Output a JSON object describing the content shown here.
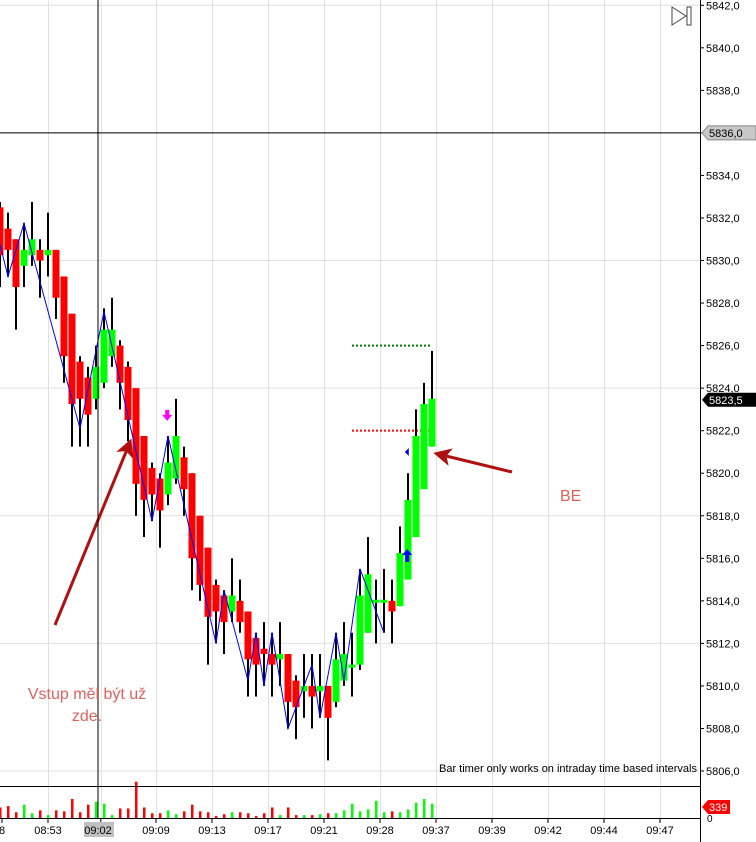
{
  "chart_data": {
    "type": "candlestick",
    "title": "",
    "price_axis": {
      "min": 5806,
      "max": 5842,
      "step": 2,
      "decimal_sep": ","
    },
    "grid_price_levels": [
      5806,
      5812,
      5818,
      5824,
      5830,
      5836,
      5842
    ],
    "price_labels": [
      "5806,0",
      "5808,0",
      "5810,0",
      "5812,0",
      "5814,0",
      "5816,0",
      "5818,0",
      "5820,0",
      "5822,0",
      "5824,0",
      "5826,0",
      "5828,0",
      "5830,0",
      "5832,0",
      "5834,0",
      "5836,0",
      "5838,0",
      "5840,0",
      "5842,0"
    ],
    "time_labels": [
      "8",
      "08:53",
      "09:02",
      "09:09",
      "09:13",
      "09:17",
      "09:21",
      "09:28",
      "09:37",
      "09:39",
      "09:42",
      "09:44",
      "09:47"
    ],
    "time_label_bar_index": [
      -6,
      6,
      12.6,
      19.5,
      26.5,
      33.5,
      40.5,
      47.5,
      54.5,
      61.5,
      68.5,
      75.5,
      82.5
    ],
    "crosshair": {
      "price": 5836,
      "price_label": "5836,0",
      "time_label": "09:02",
      "bar_index": 12.25
    },
    "current_price": {
      "value": 5823.5,
      "label": "5823,5"
    },
    "open": [
      5832.5,
      5831.5,
      5831,
      5829.75,
      5830.25,
      5830.5,
      5830.25,
      5830.5,
      5829.25,
      5827.5,
      5825.25,
      5824.5,
      5823.5,
      5824.25,
      5825.5,
      5826,
      5825,
      5824,
      5821.75,
      5820.25,
      5819.75,
      5819,
      5819.75,
      5820.75,
      5820,
      5818,
      5816.5,
      5814.75,
      5814.25,
      5813.5,
      5814,
      5813.5,
      5812.25,
      5811.75,
      5811.5,
      5811.25,
      5811.5,
      5810.25,
      5809.75,
      5810,
      5809.75,
      5810,
      5809.25,
      5810.25,
      5811,
      5811,
      5812.5,
      5814,
      5814,
      5814,
      5813.75,
      5815,
      5817,
      5819.25,
      5821.25
    ],
    "high": [
      5832.75,
      5832.25,
      5831,
      5831.75,
      5832.75,
      5831,
      5832.25,
      5830.5,
      5829.25,
      5827.5,
      5825.5,
      5825,
      5826,
      5827.75,
      5828.25,
      5826.25,
      5825.25,
      5824,
      5821.75,
      5820.5,
      5820,
      5821.75,
      5823.5,
      5821.25,
      5820,
      5818,
      5816.5,
      5815,
      5814.5,
      5816,
      5815,
      5813.5,
      5812.5,
      5813,
      5812.5,
      5813,
      5811.5,
      5810.5,
      5811.5,
      5811.5,
      5811.5,
      5810,
      5812.5,
      5813,
      5812.5,
      5815.5,
      5817,
      5815,
      5815.5,
      5815,
      5817.5,
      5820,
      5823,
      5824.25,
      5825.75
    ],
    "low": [
      5828.75,
      5829.25,
      5826.75,
      5828.75,
      5829.75,
      5828.25,
      5829.25,
      5827.25,
      5824.25,
      5821.25,
      5821.25,
      5821.25,
      5823,
      5824,
      5825,
      5823,
      5821.5,
      5818,
      5817,
      5817.75,
      5816.5,
      5818.5,
      5819.5,
      5818,
      5814.5,
      5814,
      5811,
      5812,
      5811.5,
      5813,
      5812.5,
      5809.5,
      5809.5,
      5810,
      5809.5,
      5810,
      5808,
      5807.5,
      5808.5,
      5808,
      5808.5,
      5806.5,
      5809,
      5810,
      5809.5,
      5810.75,
      5812.5,
      5812,
      5812.5,
      5812,
      5813.75,
      5815,
      5817,
      5819.25,
      5821.25
    ],
    "close": [
      5830.25,
      5830.5,
      5828.75,
      5830.5,
      5831,
      5830,
      5830.5,
      5828.25,
      5825.5,
      5823.25,
      5823.5,
      5822.75,
      5825,
      5826.75,
      5826.75,
      5824.25,
      5822.5,
      5819.5,
      5818.75,
      5819,
      5818.25,
      5820.5,
      5821.75,
      5819.25,
      5816,
      5814.75,
      5813.25,
      5813.5,
      5813,
      5814.25,
      5813,
      5811.25,
      5811,
      5811.5,
      5811,
      5811.5,
      5809.25,
      5809,
      5810,
      5809.5,
      5810,
      5808.5,
      5811.25,
      5811.5,
      5811,
      5814.25,
      5815.25,
      5814.05,
      5814.05,
      5813.5,
      5816.25,
      5818.75,
      5821.75,
      5823.25,
      5823.5
    ],
    "volume": [
      250,
      283,
      136,
      316,
      113,
      181,
      68,
      181,
      158,
      452,
      136,
      316,
      384,
      339,
      68,
      226,
      226,
      859,
      249,
      113,
      113,
      181,
      90,
      158,
      316,
      158,
      136,
      45,
      90,
      136,
      136,
      113,
      45,
      113,
      249,
      68,
      249,
      68,
      68,
      68,
      90,
      113,
      113,
      181,
      339,
      158,
      203,
      407,
      136,
      158,
      136,
      203,
      362,
      452,
      339
    ],
    "volume_axis": {
      "zero_label": "0",
      "last_label": "339",
      "max": 900
    },
    "zigzag": [
      [
        0,
        5830.75
      ],
      [
        1,
        5829.25
      ],
      [
        3,
        5831.75
      ],
      [
        10,
        5822.1
      ],
      [
        13,
        5827.6
      ],
      [
        19,
        5817.75
      ],
      [
        21,
        5821.75
      ],
      [
        27,
        5812
      ],
      [
        28,
        5814.5
      ],
      [
        31,
        5810.25
      ],
      [
        32,
        5812.5
      ],
      [
        33,
        5810
      ],
      [
        34,
        5812.5
      ],
      [
        36,
        5808
      ],
      [
        39,
        5811
      ],
      [
        40,
        5808.5
      ],
      [
        42,
        5812.5
      ],
      [
        43,
        5810.25
      ],
      [
        45,
        5815.5
      ],
      [
        48,
        5812.5
      ]
    ],
    "signals": [
      {
        "type": "sell-arrow",
        "bar": 20.9,
        "price": 5822.6,
        "color": "#ff00ff"
      },
      {
        "type": "buy-arrow",
        "bar": 50.9,
        "price": 5816.2,
        "color": "#0000ff"
      },
      {
        "type": "entry-diamond",
        "bar": 51.1,
        "price": 5821,
        "color": "#0000ff"
      }
    ],
    "levels": [
      {
        "name": "target",
        "price": 5826,
        "from_bar": 44,
        "to_bar": 54,
        "color": "#008000"
      },
      {
        "name": "stop",
        "price": 5822,
        "from_bar": 44,
        "to_bar": 54,
        "color": "#ff0000"
      }
    ],
    "colors": {
      "up": "#00ff00",
      "down": "#ff0000",
      "wick": "#000000",
      "zigzag": "#0000ff",
      "grid": "#e0e0e0",
      "annotation": "#b01010"
    }
  },
  "annotations": {
    "entry_note_line1": "Vstup měl být už",
    "entry_note_line2": "zde.",
    "be_note": "BE"
  },
  "status": {
    "bar_timer": "Bar timer only works on intraday time based intervals"
  }
}
